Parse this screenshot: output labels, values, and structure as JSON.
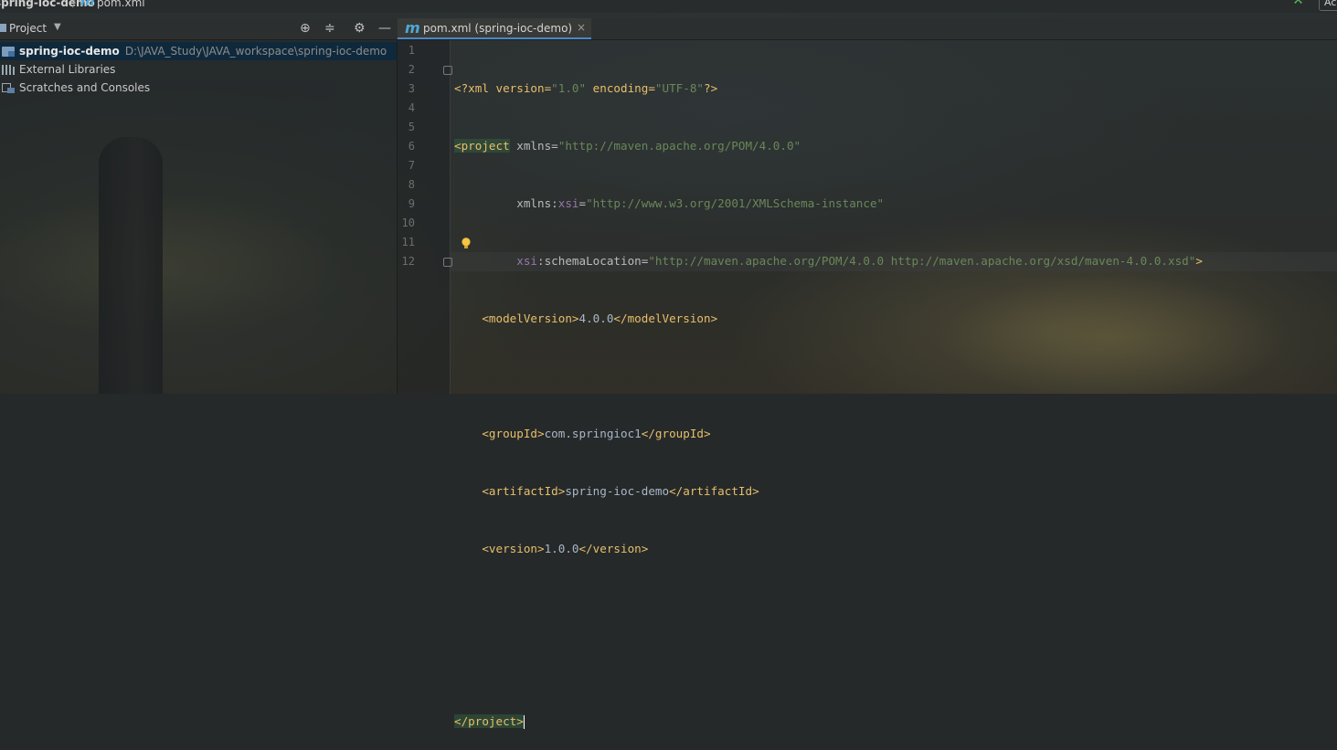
{
  "breadcrumb": {
    "project": "spring-ioc-demo",
    "separator": "/",
    "file_icon": "m",
    "file": "pom.xml",
    "add_button": "Ac"
  },
  "project_panel": {
    "title": "Project",
    "tools": [
      "target-icon",
      "collapse-icon",
      "gear-icon",
      "minimize-icon"
    ],
    "items": [
      {
        "label": "spring-ioc-demo",
        "path": "D:\\JAVA_Study\\JAVA_workspace\\spring-ioc-demo",
        "icon": "module-folder-icon",
        "selected": true
      },
      {
        "label": "External Libraries",
        "icon": "libraries-icon"
      },
      {
        "label": "Scratches and Consoles",
        "icon": "scratches-icon"
      }
    ]
  },
  "editor": {
    "tab": {
      "icon": "m",
      "label": "pom.xml (spring-ioc-demo)",
      "close": "×"
    },
    "line_numbers": [
      "1",
      "2",
      "3",
      "4",
      "5",
      "6",
      "7",
      "8",
      "9",
      "10",
      "11",
      "12"
    ],
    "code": {
      "l1": {
        "a": "<?xml version=",
        "b": "\"1.0\"",
        "c": " encoding=",
        "d": "\"UTF-8\"",
        "e": "?>"
      },
      "l2": {
        "tag": "<project",
        "attr": " xmlns=",
        "val": "\"http://maven.apache.org/POM/4.0.0\""
      },
      "l3": {
        "indent": "         ",
        "attr": "xmlns:",
        "ns": "xsi",
        "eq": "=",
        "val": "\"http://www.w3.org/2001/XMLSchema-instance\""
      },
      "l4": {
        "indent": "         ",
        "ns": "xsi",
        "attr": ":schemaLocation=",
        "val": "\"http://maven.apache.org/POM/4.0.0 http://maven.apache.org/xsd/maven-4.0.0.xsd\"",
        "close": ">"
      },
      "l5": {
        "indent": "    ",
        "open": "<modelVersion>",
        "text": "4.0.0",
        "close": "</modelVersion>"
      },
      "l7": {
        "indent": "    ",
        "open": "<groupId>",
        "text": "com.springioc1",
        "close": "</groupId>"
      },
      "l8": {
        "indent": "    ",
        "open": "<artifactId>",
        "text": "spring-ioc-demo",
        "close": "</artifactId>"
      },
      "l9": {
        "indent": "    ",
        "open": "<version>",
        "text": "1.0.0",
        "close": "</version>"
      },
      "l12": {
        "tag": "</project",
        "close": ">"
      }
    }
  },
  "colors": {
    "tag": "#e8bf6a",
    "value": "#6a8759",
    "namespace": "#9876aa",
    "text": "#a9b7c6",
    "selection": "#0d293e",
    "tab_underline": "#4a88c7"
  }
}
